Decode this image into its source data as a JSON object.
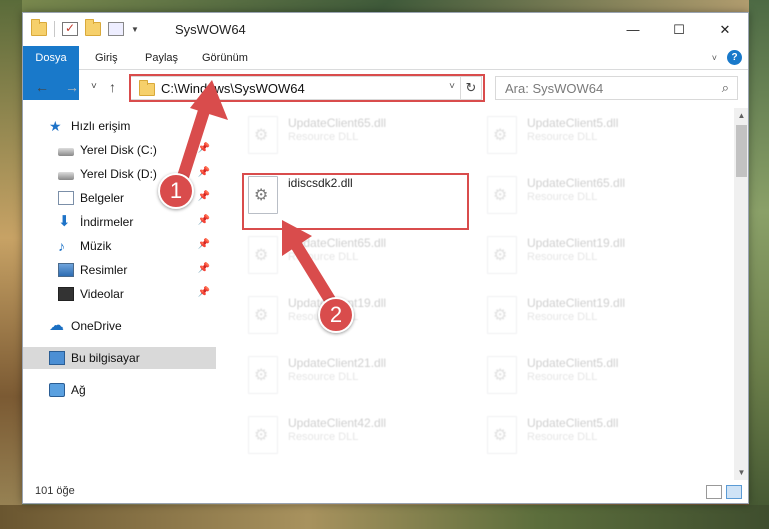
{
  "window": {
    "title": "SysWOW64",
    "controls": {
      "minimize": "—",
      "maximize": "☐",
      "close": "✕"
    }
  },
  "ribbon": {
    "tabs": [
      "Dosya",
      "Giriş",
      "Paylaş",
      "Görünüm"
    ],
    "help": "?"
  },
  "navigation": {
    "back": "←",
    "forward": "→",
    "recent": "˅",
    "up": "↑",
    "address": "C:\\Windows\\SysWOW64",
    "refresh": "↻",
    "search_placeholder": "Ara: SysWOW64"
  },
  "sidebar": {
    "items": [
      {
        "label": "Hızlı erişim",
        "icon": "star-icon"
      },
      {
        "label": "Yerel Disk (C:)",
        "icon": "drive-icon",
        "pinned": true
      },
      {
        "label": "Yerel Disk (D:)",
        "icon": "drive-icon",
        "pinned": true
      },
      {
        "label": "Belgeler",
        "icon": "documents-icon",
        "pinned": true
      },
      {
        "label": "İndirmeler",
        "icon": "download-icon",
        "pinned": true
      },
      {
        "label": "Müzik",
        "icon": "music-icon",
        "pinned": true
      },
      {
        "label": "Resimler",
        "icon": "pictures-icon",
        "pinned": true
      },
      {
        "label": "Videolar",
        "icon": "videos-icon",
        "pinned": true
      },
      {
        "label": "OneDrive",
        "icon": "cloud-icon"
      },
      {
        "label": "Bu bilgisayar",
        "icon": "computer-icon",
        "selected": true
      },
      {
        "label": "Ağ",
        "icon": "network-icon"
      }
    ]
  },
  "files": {
    "highlighted": {
      "name": "idiscsdk2.dll"
    },
    "background_items": [
      {
        "name": "UpdateClient65.dll",
        "type": "Resource DLL"
      },
      {
        "name": "UpdateClient5.dll",
        "type": "Resource DLL"
      },
      {
        "name": "UpdateClient65.dll",
        "type": "Resource DLL"
      },
      {
        "name": "UpdateClient65.dll",
        "type": "Resource DLL"
      },
      {
        "name": "UpdateClient19.dll",
        "type": "Resource DLL"
      },
      {
        "name": "UpdateClient19.dll",
        "type": "Resource DLL"
      },
      {
        "name": "UpdateClient19.dll",
        "type": "Resource DLL"
      },
      {
        "name": "UpdateClient21.dll",
        "type": "Resource DLL"
      },
      {
        "name": "UpdateClient5.dll",
        "type": "Resource DLL"
      },
      {
        "name": "UpdateClient42.dll",
        "type": "Resource DLL"
      },
      {
        "name": "UpdateClient5.dll",
        "type": "Resource DLL"
      }
    ]
  },
  "status": {
    "count": "101 öğe"
  },
  "annotations": {
    "step1": "1",
    "step2": "2",
    "color": "#d94c4c"
  }
}
